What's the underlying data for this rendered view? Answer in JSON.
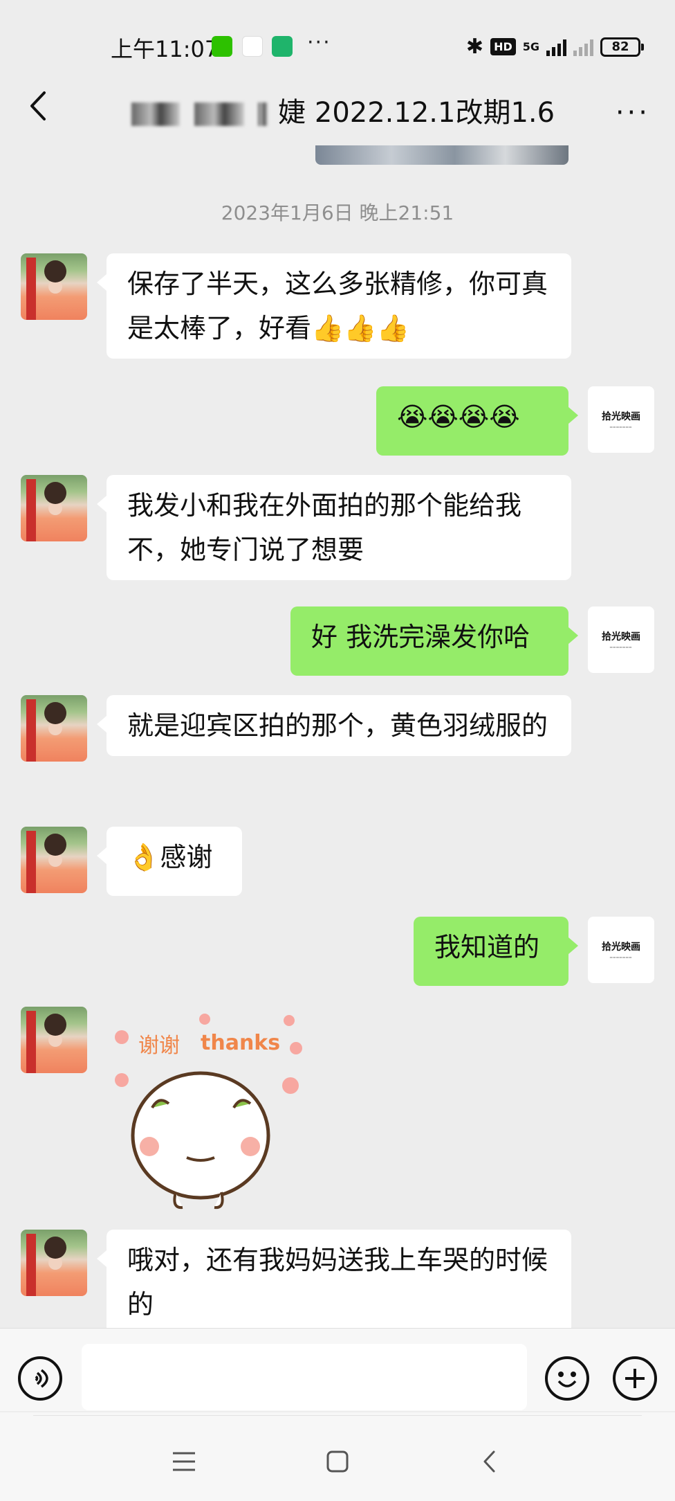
{
  "status_bar": {
    "time": "上午11:07",
    "network": "5G",
    "hd": "HD",
    "battery": "82"
  },
  "header": {
    "title": "婕 2022.12.1改期1.6"
  },
  "chat": {
    "timestamp": "2023年1月6日 晚上21:51",
    "self_avatar_brand": "拾光映画",
    "messages": [
      {
        "side": "left",
        "text": "保存了半天，这么多张精修，你可真是太棒了，好看👍👍👍"
      },
      {
        "side": "right",
        "text": "😭😭😭😭"
      },
      {
        "side": "left",
        "text": "我发小和我在外面拍的那个能给我不，她专门说了想要"
      },
      {
        "side": "right",
        "text": "好 我洗完澡发你哈"
      },
      {
        "side": "left",
        "text": "就是迎宾区拍的那个，黄色羽绒服的"
      },
      {
        "side": "left",
        "text": "👌感谢"
      },
      {
        "side": "right",
        "text": "我知道的"
      },
      {
        "side": "left",
        "text": "哦对，还有我妈妈送我上车哭的时候的"
      }
    ],
    "sticker": {
      "text_cn": "谢谢",
      "text_en": "thanks"
    }
  },
  "colors": {
    "background": "#ededed",
    "self_bubble": "#95ec69",
    "other_bubble": "#ffffff"
  }
}
